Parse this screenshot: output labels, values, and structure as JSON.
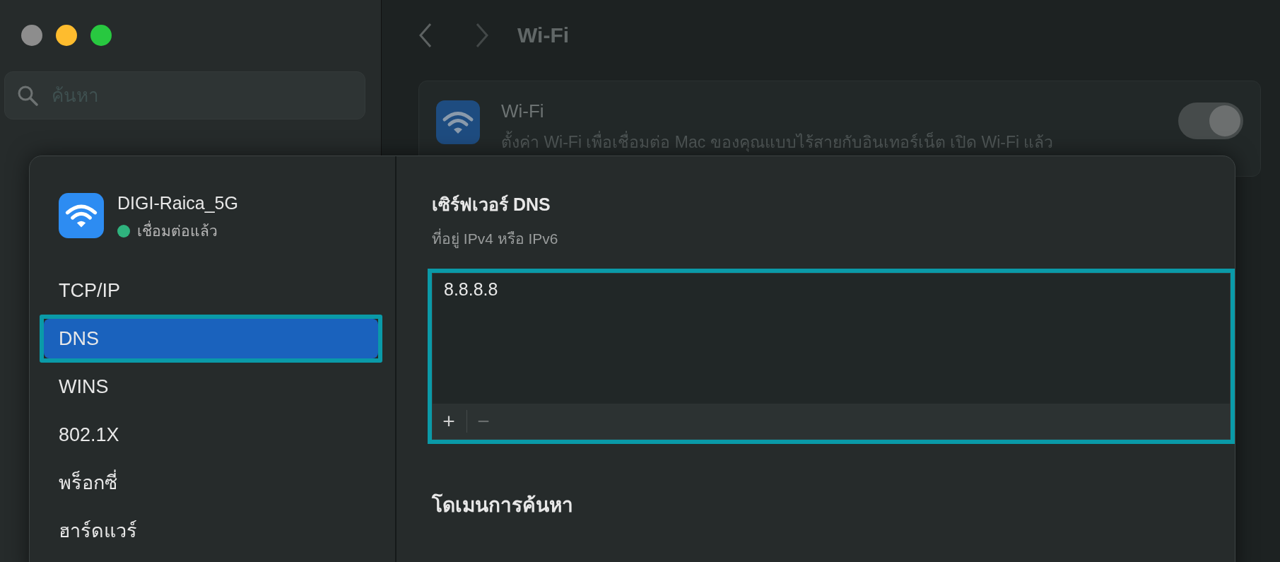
{
  "window_controls": [
    {
      "color": "#8d8d8d"
    },
    {
      "color": "#febc2e"
    },
    {
      "color": "#28c840"
    }
  ],
  "sidebar": {
    "search": {
      "placeholder": "ค้นหา"
    }
  },
  "toolbar": {
    "title": "Wi-Fi"
  },
  "wifi_card": {
    "title": "Wi-Fi",
    "description": "ตั้งค่า Wi-Fi เพื่อเชื่อมต่อ Mac ของคุณแบบไร้สายกับอินเทอร์เน็ต เปิด Wi-Fi แล้ว",
    "on": true
  },
  "sheet": {
    "network": {
      "name": "DIGI-Raica_5G",
      "status": "เชื่อมต่อแล้ว",
      "connected": true
    },
    "tabs": [
      {
        "label": "TCP/IP",
        "selected": false,
        "highlighted": false
      },
      {
        "label": "DNS",
        "selected": true,
        "highlighted": true
      },
      {
        "label": "WINS",
        "selected": false,
        "highlighted": false
      },
      {
        "label": "802.1X",
        "selected": false,
        "highlighted": false
      },
      {
        "label": "พร็อกซี่",
        "selected": false,
        "highlighted": false
      },
      {
        "label": "ฮาร์ดแวร์",
        "selected": false,
        "highlighted": false
      }
    ],
    "dns": {
      "title": "เซิร์ฟเวอร์ DNS",
      "subtitle": "ที่อยู่ IPv4 หรือ IPv6",
      "servers": [
        "8.8.8.8"
      ],
      "highlighted": true,
      "add_label": "+",
      "remove_label": "−"
    },
    "search_domains": {
      "title": "โดเมนการค้นหา"
    }
  }
}
